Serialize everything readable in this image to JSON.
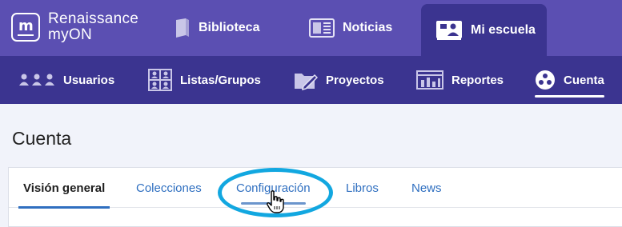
{
  "brand": {
    "line1": "Renaissance",
    "line2": "myON"
  },
  "top_nav": [
    {
      "label": "Biblioteca",
      "icon": "book-icon",
      "active": false
    },
    {
      "label": "Noticias",
      "icon": "newspaper-icon",
      "active": false
    },
    {
      "label": "Mi escuela",
      "icon": "classroom-board-icon",
      "active": true
    }
  ],
  "sub_nav": [
    {
      "label": "Usuarios",
      "icon": "users-icon",
      "active": false
    },
    {
      "label": "Listas/Grupos",
      "icon": "groups-icon",
      "active": false
    },
    {
      "label": "Proyectos",
      "icon": "folder-pencil-icon",
      "active": false
    },
    {
      "label": "Reportes",
      "icon": "reports-icon",
      "active": false
    },
    {
      "label": "Cuenta",
      "icon": "account-icon",
      "active": true
    }
  ],
  "page": {
    "title": "Cuenta"
  },
  "tabs": [
    {
      "label": "Visión general",
      "active": true
    },
    {
      "label": "Colecciones",
      "active": false
    },
    {
      "label": "Configuración",
      "active": false,
      "highlighted": true
    },
    {
      "label": "Libros",
      "active": false
    },
    {
      "label": "News",
      "active": false
    }
  ],
  "colors": {
    "top_bar": "#5b4fb2",
    "sub_nav": "#3b3490",
    "link": "#2f6fc0",
    "highlight_ring": "#12a7e0",
    "page_bg": "#f1f3fa"
  }
}
